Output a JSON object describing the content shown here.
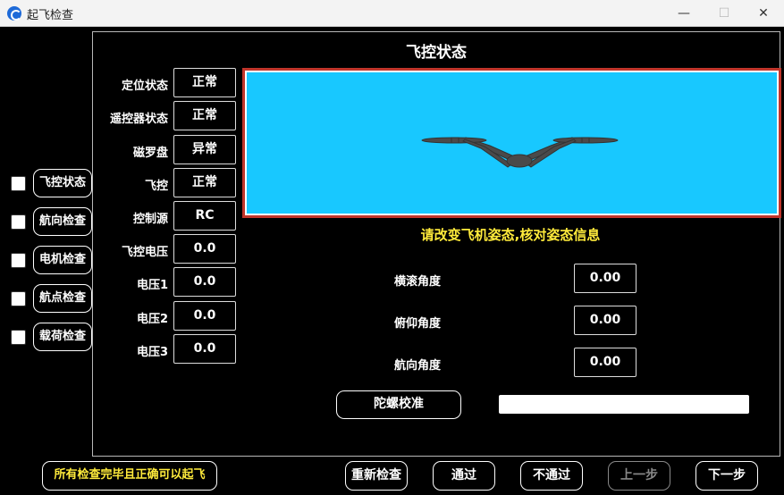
{
  "window": {
    "title": "起飞检查",
    "minimize_glyph": "—",
    "maximize_glyph": "☐",
    "close_glyph": "✕"
  },
  "checklist": [
    {
      "label": "飞控状态",
      "checked": false
    },
    {
      "label": "航向检查",
      "checked": false
    },
    {
      "label": "电机检查",
      "checked": false
    },
    {
      "label": "航点检查",
      "checked": false
    },
    {
      "label": "载荷检查",
      "checked": false
    }
  ],
  "panel": {
    "title": "飞控状态",
    "status": [
      {
        "label": "定位状态",
        "value": "正常"
      },
      {
        "label": "遥控器状态",
        "value": "正常"
      },
      {
        "label": "磁罗盘",
        "value": "异常"
      },
      {
        "label": "飞控",
        "value": "正常"
      },
      {
        "label": "控制源",
        "value": "RC"
      },
      {
        "label": "飞控电压",
        "value": "0.0"
      },
      {
        "label": "电压1",
        "value": "0.0"
      },
      {
        "label": "电压2",
        "value": "0.0"
      },
      {
        "label": "电压3",
        "value": "0.0"
      }
    ],
    "instruction": "请改变飞机姿态,核对姿态信息",
    "attitude": [
      {
        "label": "横滚角度",
        "value": "0.00"
      },
      {
        "label": "俯仰角度",
        "value": "0.00"
      },
      {
        "label": "航向角度",
        "value": "0.00"
      }
    ],
    "gyro_button": "陀螺校准",
    "gyro_progress": 0,
    "view_background": "#18c8ff",
    "frame_color": "#c0352b"
  },
  "bottom": {
    "ready_note": "所有检查完毕且正确可以起飞",
    "recheck": "重新检查",
    "pass": "通过",
    "fail": "不通过",
    "prev": "上一步",
    "next": "下一步"
  },
  "colors": {
    "highlight_text": "#ffeb3b",
    "background": "#000000"
  }
}
